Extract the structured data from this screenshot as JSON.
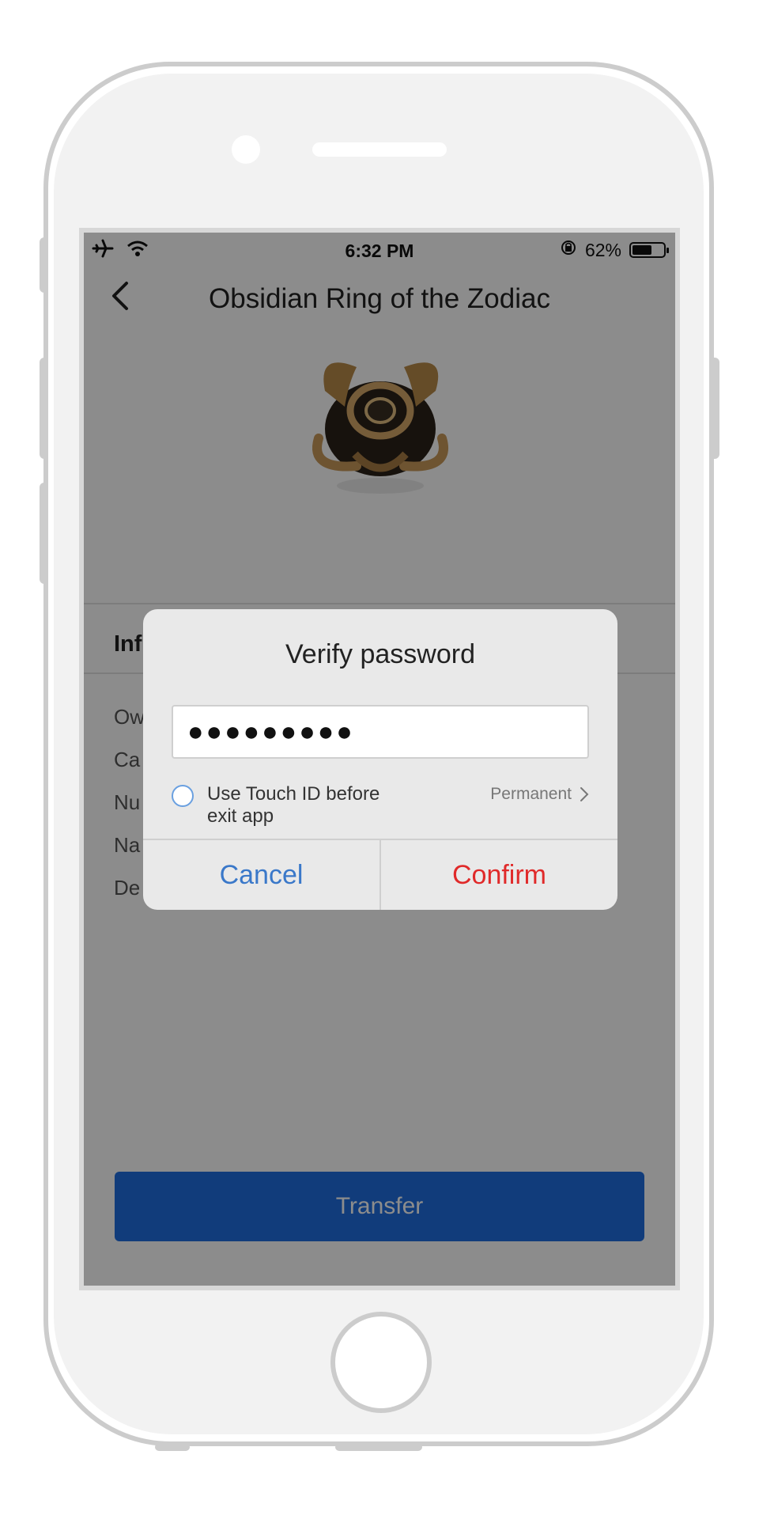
{
  "status_bar": {
    "time": "6:32 PM",
    "battery_percent": "62%",
    "battery_level": 0.62,
    "icons": [
      "airplane-icon",
      "wifi-icon",
      "orientation-lock-icon",
      "battery-icon"
    ]
  },
  "nav": {
    "title": "Obsidian Ring of the Zodiac",
    "back_icon": "chevron-left-icon"
  },
  "info": {
    "section_title": "Inf",
    "labels": [
      "Ow",
      "Ca",
      "Nu",
      "Na",
      "De"
    ]
  },
  "actions": {
    "transfer_label": "Transfer"
  },
  "dialog": {
    "title": "Verify password",
    "password_value": "●●●●●●●●●",
    "touch_id_label": "Use Touch ID before exit app",
    "duration_label": "Permanent",
    "cancel_label": "Cancel",
    "confirm_label": "Confirm"
  },
  "colors": {
    "primary": "#1f6ee0",
    "cancel_text": "#3a78c9",
    "confirm_text": "#e02a2a",
    "dialog_bg": "#e9e9e9",
    "overlay": "rgba(0,0,0,0.45)"
  }
}
